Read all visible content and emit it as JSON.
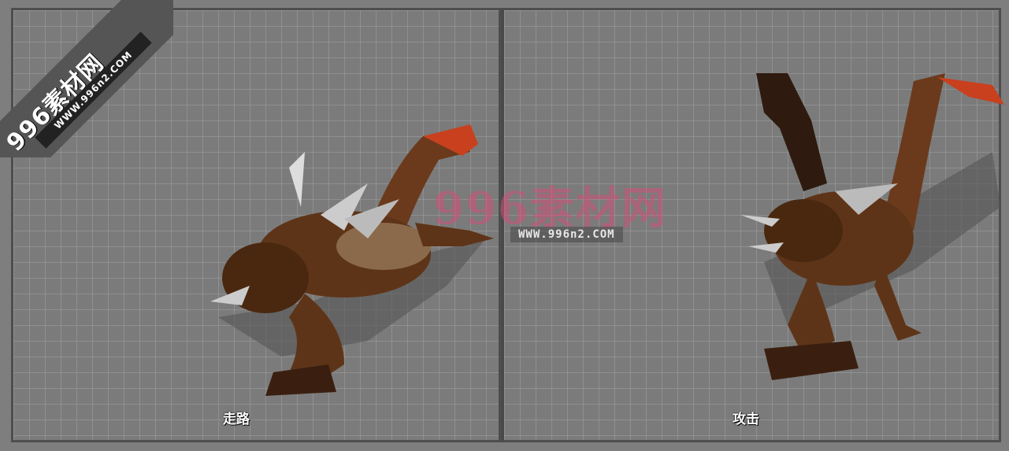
{
  "logo": {
    "brand": "996素材网",
    "url": "WWW.996n2.COM"
  },
  "watermark": {
    "brand": "996素材网",
    "url": "WWW.996n2.COM"
  },
  "panels": [
    {
      "caption": "走路"
    },
    {
      "caption": "攻击"
    }
  ],
  "colors": {
    "background": "#7b7b7b",
    "grid": "#a0a0a0",
    "divider": "#4a4a4a",
    "creature_body": "#6b3a1c",
    "creature_claw": "#c8401e"
  }
}
